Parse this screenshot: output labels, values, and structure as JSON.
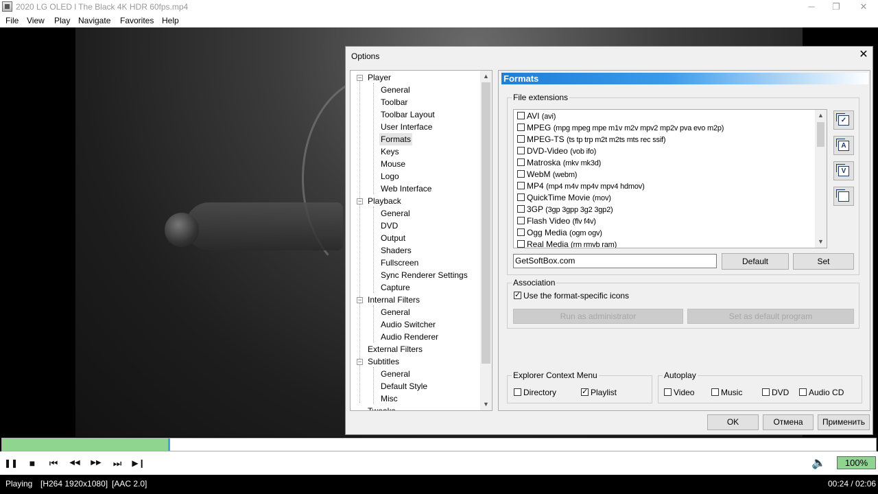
{
  "window": {
    "title": "2020 LG OLED l The Black 4K HDR 60fps.mp4",
    "minimize": "─",
    "maximize": "❐",
    "close": "✕"
  },
  "menu": [
    "File",
    "View",
    "Play",
    "Navigate",
    "Favorites",
    "Help"
  ],
  "dialog": {
    "title": "Options",
    "close": "✕",
    "tree": {
      "player": "Player",
      "player_children": [
        "General",
        "Toolbar",
        "Toolbar Layout",
        "User Interface",
        "Formats",
        "Keys",
        "Mouse",
        "Logo",
        "Web Interface"
      ],
      "playback": "Playback",
      "playback_children": [
        "General",
        "DVD",
        "Output",
        "Shaders",
        "Fullscreen",
        "Sync Renderer Settings",
        "Capture"
      ],
      "internal_filters": "Internal Filters",
      "internal_children": [
        "General",
        "Audio Switcher",
        "Audio Renderer"
      ],
      "external_filters": "External Filters",
      "subtitles": "Subtitles",
      "subtitles_children": [
        "General",
        "Default Style",
        "Misc"
      ],
      "partial": "Tweaks",
      "selected": "Formats",
      "expand_symbol": "−",
      "scroll_up": "▲",
      "scroll_down": "▼"
    },
    "page_title": "Formats",
    "file_extensions": {
      "label": "File extensions",
      "items": [
        {
          "name": "AVI",
          "ext": "(avi)"
        },
        {
          "name": "MPEG",
          "ext": "(mpg mpeg mpe m1v m2v mpv2 mp2v pva evo m2p)"
        },
        {
          "name": "MPEG-TS",
          "ext": "(ts tp trp m2t m2ts mts rec ssif)"
        },
        {
          "name": "DVD-Video",
          "ext": "(vob ifo)"
        },
        {
          "name": "Matroska",
          "ext": "(mkv mk3d)"
        },
        {
          "name": "WebM",
          "ext": "(webm)"
        },
        {
          "name": "MP4",
          "ext": "(mp4 m4v mp4v mpv4 hdmov)"
        },
        {
          "name": "QuickTime Movie",
          "ext": "(mov)"
        },
        {
          "name": "3GP",
          "ext": "(3gp 3gpp 3g2 3gp2)"
        },
        {
          "name": "Flash Video",
          "ext": "(flv f4v)"
        },
        {
          "name": "Ogg Media",
          "ext": "(ogm ogv)"
        },
        {
          "name": "Real Media",
          "ext": "(rm rmvb ram)"
        }
      ],
      "side_buttons": [
        "all",
        "A",
        "V",
        "none"
      ],
      "input_value": "GetSoftBox.com",
      "default_button": "Default",
      "set_button": "Set"
    },
    "association": {
      "label": "Association",
      "checkbox": "Use the format-specific icons",
      "checked": true,
      "run_admin": "Run as administrator",
      "set_default": "Set as default program"
    },
    "explorer": {
      "label": "Explorer Context Menu",
      "directory": "Directory",
      "directory_checked": false,
      "playlist": "Playlist",
      "playlist_checked": true
    },
    "autoplay": {
      "label": "Autoplay",
      "video": "Video",
      "music": "Music",
      "dvd": "DVD",
      "audio_cd": "Audio CD"
    },
    "buttons": {
      "ok": "OK",
      "cancel": "Отмена",
      "apply": "Применить"
    }
  },
  "player": {
    "progress": 0.19,
    "volume": "100%",
    "status": "Playing",
    "video_info": "[H264 1920x1080]",
    "audio_info": "[AAC 2.0]",
    "time": "00:24 / 02:06",
    "icons": {
      "pause": "❚❚",
      "stop": "■",
      "prev": "⏮",
      "rewind": "◀◀",
      "forward": "▶▶",
      "next": "⏭",
      "frame_step": "▶❙",
      "volume": "🔈"
    },
    "colors": {
      "progress_fill": "#8fd48f",
      "volume_fill": "#8fd48f"
    }
  }
}
